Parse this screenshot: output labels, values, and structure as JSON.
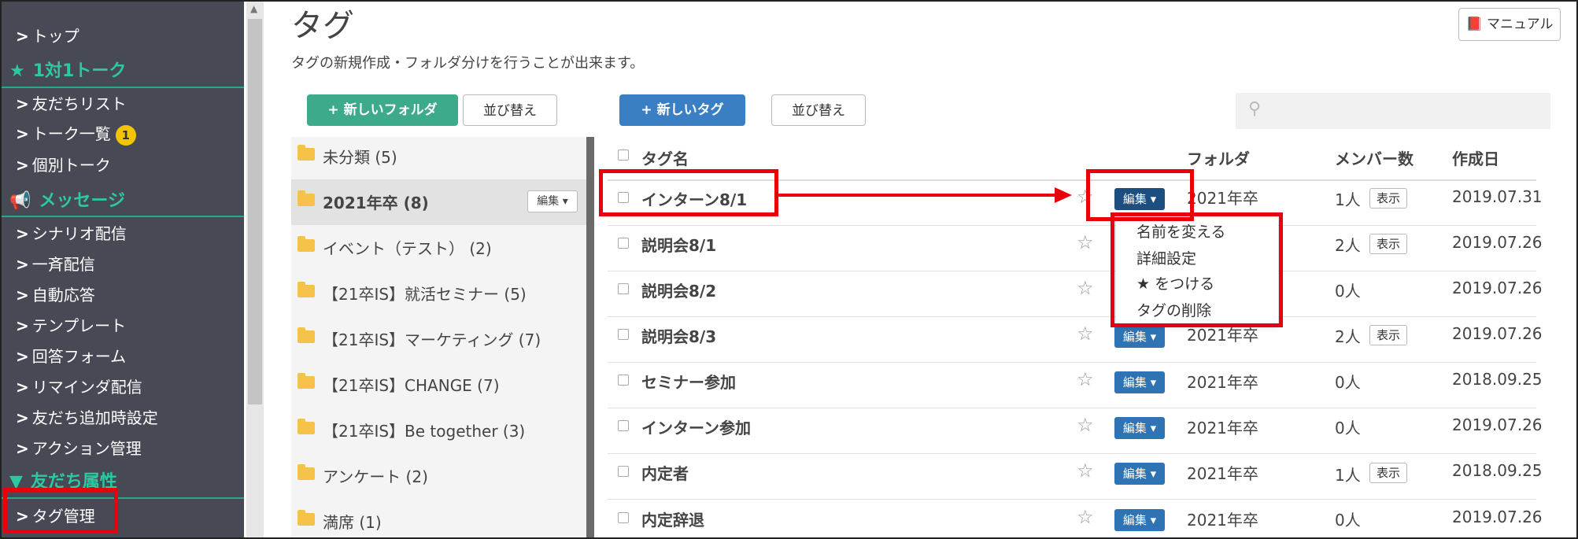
{
  "sidebar": {
    "items": [
      {
        "label": "トップ"
      },
      {
        "label": "友だちリスト"
      },
      {
        "label": "トーク一覧",
        "badge": "1"
      },
      {
        "label": "個別トーク"
      },
      {
        "label": "シナリオ配信"
      },
      {
        "label": "一斉配信"
      },
      {
        "label": "自動応答"
      },
      {
        "label": "テンプレート"
      },
      {
        "label": "回答フォーム"
      },
      {
        "label": "リマインダ配信"
      },
      {
        "label": "友だち追加時設定"
      },
      {
        "label": "アクション管理"
      },
      {
        "label": "タグ管理"
      }
    ],
    "sections": [
      {
        "label": "1対1トーク",
        "icon": "star-icon"
      },
      {
        "label": "メッセージ",
        "icon": "megaphone-icon"
      },
      {
        "label": "友だち属性",
        "icon": "filter-icon"
      }
    ],
    "accent": "#2cc8a0"
  },
  "header": {
    "title": "タグ",
    "description": "タグの新規作成・フォルダ分けを行うことが出来ます。",
    "manual_label": "マニュアル"
  },
  "toolbar": {
    "new_folder_label": "新しいフォルダ",
    "sort_folder_label": "並び替え",
    "new_tag_label": "新しいタグ",
    "sort_tag_label": "並び替え",
    "search_placeholder": ""
  },
  "folders": [
    {
      "label": "未分類 (5)"
    },
    {
      "label": "2021年卒 (8)",
      "edit_label": "編集"
    },
    {
      "label": "イベント（テスト） (2)"
    },
    {
      "label": "【21卒IS】就活セミナー (5)"
    },
    {
      "label": "【21卒IS】マーケティング (7)"
    },
    {
      "label": "【21卒IS】CHANGE (7)"
    },
    {
      "label": "【21卒IS】Be together (3)"
    },
    {
      "label": "アンケート (2)"
    },
    {
      "label": "満席 (1)"
    }
  ],
  "table": {
    "headers": {
      "name": "タグ名",
      "folder": "フォルダ",
      "members": "メンバー数",
      "created": "作成日"
    },
    "edit_label": "編集",
    "show_label": "表示",
    "rows": [
      {
        "name": "インターン8/1",
        "folder": "2021年卒",
        "members": "1人",
        "show": true,
        "created": "2019.07.31"
      },
      {
        "name": "説明会8/1",
        "folder": "",
        "members": "2人",
        "show": true,
        "created": "2019.07.26"
      },
      {
        "name": "説明会8/2",
        "folder": "",
        "members": "0人",
        "show": false,
        "created": "2019.07.26"
      },
      {
        "name": "説明会8/3",
        "folder": "2021年卒",
        "members": "2人",
        "show": true,
        "created": "2019.07.26"
      },
      {
        "name": "セミナー参加",
        "folder": "2021年卒",
        "members": "0人",
        "show": false,
        "created": "2018.09.25"
      },
      {
        "name": "インターン参加",
        "folder": "2021年卒",
        "members": "0人",
        "show": false,
        "created": "2019.07.26"
      },
      {
        "name": "内定者",
        "folder": "2021年卒",
        "members": "1人",
        "show": true,
        "created": "2018.09.25"
      },
      {
        "name": "内定辞退",
        "folder": "2021年卒",
        "members": "0人",
        "show": false,
        "created": "2019.07.26"
      }
    ]
  },
  "dropdown": {
    "items": [
      {
        "label": "名前を変える"
      },
      {
        "label": "詳細設定"
      },
      {
        "label": "★ をつける"
      },
      {
        "label": "タグの削除"
      }
    ]
  },
  "colors": {
    "highlight": "#e8000b",
    "primary": "#3a7fc4",
    "success": "#3daa8c"
  }
}
